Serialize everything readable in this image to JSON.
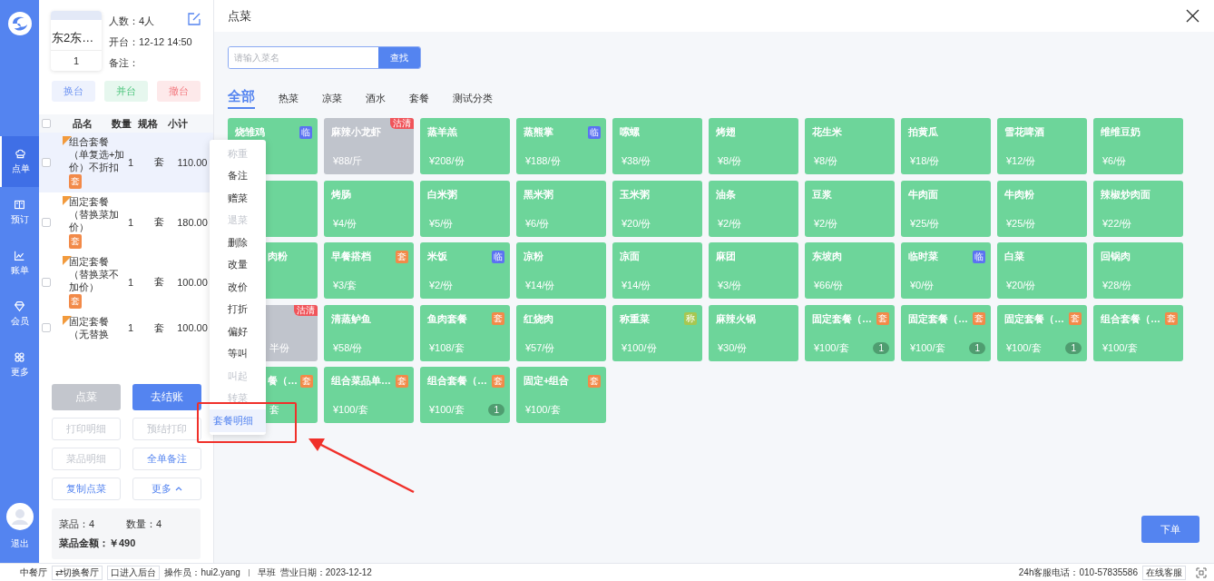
{
  "nav": {
    "items": [
      {
        "label": "点单",
        "selected": true
      },
      {
        "label": "预订",
        "selected": false
      },
      {
        "label": "账单",
        "selected": false
      },
      {
        "label": "会员",
        "selected": false
      },
      {
        "label": "更多",
        "selected": false
      }
    ],
    "logout": "退出"
  },
  "order": {
    "table_name": "东2东…",
    "table_no": "1",
    "guests": "人数：4人",
    "opened": "开台：12-12 14:50",
    "note": "备注：",
    "table_actions": [
      {
        "label": "换台",
        "kind": "blue"
      },
      {
        "label": "并台",
        "kind": "green"
      },
      {
        "label": "撤台",
        "kind": "red"
      }
    ],
    "columns": [
      "品名",
      "数量",
      "规格",
      "小计"
    ],
    "select_all_checked": false,
    "rows": [
      {
        "name": "组合套餐（单复选+加价）不折扣",
        "tag": "套",
        "qty": "1",
        "unit": "套",
        "subtotal": "110.00",
        "selected": true,
        "checked": false
      },
      {
        "name": "固定套餐（替换菜加价）",
        "tag": "套",
        "qty": "1",
        "unit": "套",
        "subtotal": "180.00",
        "selected": false,
        "checked": false
      },
      {
        "name": "固定套餐（替换菜不加价）",
        "tag": "套",
        "qty": "1",
        "unit": "套",
        "subtotal": "100.00",
        "selected": false,
        "checked": false
      },
      {
        "name": "固定套餐（无替换",
        "qty": "1",
        "unit": "套",
        "subtotal": "100.00",
        "selected": false,
        "checked": false
      }
    ],
    "buttons": [
      {
        "label": "点菜",
        "kind": "grey"
      },
      {
        "label": "去结账",
        "kind": "primary"
      },
      {
        "label": "打印明细",
        "kind": "disabled"
      },
      {
        "label": "预结打印",
        "kind": "disabled"
      },
      {
        "label": "菜品明细",
        "kind": "disabled"
      },
      {
        "label": "全单备注",
        "kind": "outline"
      },
      {
        "label": "复制点菜",
        "kind": "outline"
      },
      {
        "label": "更多",
        "kind": "more"
      }
    ],
    "summary": {
      "items": "菜品：4",
      "quantity": "数量：4",
      "amount": "菜品金额：￥490"
    }
  },
  "panel": {
    "title": "点菜",
    "search": {
      "placeholder": "请输入菜名",
      "button": "查找"
    },
    "categories": [
      {
        "label": "全部",
        "selected": true
      },
      {
        "label": "热菜",
        "selected": false
      },
      {
        "label": "凉菜",
        "selected": false
      },
      {
        "label": "酒水",
        "selected": false
      },
      {
        "label": "套餐",
        "selected": false
      },
      {
        "label": "测试分类",
        "selected": false
      }
    ],
    "dishes": [
      {
        "name": "烧雏鸡",
        "tag": {
          "text": "临",
          "kind": "temp"
        },
        "clipped": false,
        "sold_out": false
      },
      {
        "name": "麻辣小龙虾",
        "price": "¥88/斤",
        "sold_out": true,
        "sold_out_label": "沽清",
        "clipped": false
      },
      {
        "name": "蒸羊羔",
        "price": "¥208/份",
        "sold_out": false,
        "clipped": false
      },
      {
        "name": "蒸熊掌",
        "tag": {
          "text": "临",
          "kind": "temp"
        },
        "price": "¥188/份",
        "sold_out": false,
        "clipped": false
      },
      {
        "name": "嗦螺",
        "price": "¥38/份",
        "sold_out": false,
        "clipped": false
      },
      {
        "name": "烤翅",
        "price": "¥8/份",
        "sold_out": false,
        "clipped": false
      },
      {
        "name": "花生米",
        "price": "¥8/份",
        "sold_out": false,
        "clipped": false
      },
      {
        "name": "拍黄瓜",
        "price": "¥18/份",
        "sold_out": false,
        "clipped": false
      },
      {
        "name": "雪花啤酒",
        "price": "¥12/份",
        "sold_out": false,
        "clipped": false
      },
      {
        "name": "维维豆奶",
        "price": "¥6/份",
        "sold_out": false,
        "clipped": false
      },
      {
        "sold_out": false
      },
      {
        "name": "烤肠",
        "price": "¥4/份",
        "sold_out": false,
        "clipped": false
      },
      {
        "name": "白米粥",
        "price": "¥5/份",
        "sold_out": false,
        "clipped": false
      },
      {
        "name": "黑米粥",
        "price": "¥6/份",
        "sold_out": false,
        "clipped": false
      },
      {
        "name": "玉米粥",
        "price": "¥20/份",
        "sold_out": false,
        "clipped": false
      },
      {
        "name": "油条",
        "price": "¥2/份",
        "sold_out": false,
        "clipped": false
      },
      {
        "name": "豆浆",
        "price": "¥2/份",
        "sold_out": false,
        "clipped": false
      },
      {
        "name": "牛肉面",
        "price": "¥25/份",
        "sold_out": false,
        "clipped": false
      },
      {
        "name": "牛肉粉",
        "price": "¥25/份",
        "sold_out": false,
        "clipped": false
      },
      {
        "name": "辣椒炒肉面",
        "price": "¥22/份",
        "sold_out": false,
        "clipped": false
      },
      {
        "name": "肉粉",
        "sold_out": false,
        "clipped": true
      },
      {
        "name": "早餐搭档",
        "tag": {
          "text": "套",
          "kind": "set"
        },
        "price": "¥3/套",
        "sold_out": false,
        "clipped": false
      },
      {
        "name": "米饭",
        "tag": {
          "text": "临",
          "kind": "temp"
        },
        "price": "¥2/份",
        "sold_out": false,
        "clipped": false
      },
      {
        "name": "凉粉",
        "price": "¥14/份",
        "sold_out": false,
        "clipped": false
      },
      {
        "name": "凉面",
        "price": "¥14/份",
        "sold_out": false,
        "clipped": false
      },
      {
        "name": "麻团",
        "price": "¥3/份",
        "sold_out": false,
        "clipped": false
      },
      {
        "name": "东坡肉",
        "price": "¥66/份",
        "sold_out": false,
        "clipped": false
      },
      {
        "name": "临时菜",
        "tag": {
          "text": "临",
          "kind": "temp"
        },
        "price": "¥0/份",
        "sold_out": false,
        "clipped": false
      },
      {
        "name": "白菜",
        "price": "¥20/份",
        "sold_out": false,
        "clipped": false
      },
      {
        "name": "回锅肉",
        "price": "¥28/份",
        "sold_out": false,
        "clipped": false
      },
      {
        "price": "半份",
        "sold_out": true,
        "sold_out_label": "沽清",
        "clipped": true
      },
      {
        "name": "清蒸鲈鱼",
        "price": "¥58/份",
        "sold_out": false,
        "clipped": false
      },
      {
        "name": "鱼肉套餐",
        "tag": {
          "text": "套",
          "kind": "set"
        },
        "price": "¥108/套",
        "sold_out": false,
        "clipped": false
      },
      {
        "name": "红烧肉",
        "price": "¥57/份",
        "sold_out": false,
        "clipped": false
      },
      {
        "name": "称重菜",
        "tag": {
          "text": "称",
          "kind": "weight"
        },
        "price": "¥100/份",
        "sold_out": false,
        "clipped": false
      },
      {
        "name": "麻辣火锅",
        "price": "¥30/份",
        "sold_out": false,
        "clipped": false
      },
      {
        "name": "固定套餐（…",
        "tag": {
          "text": "套",
          "kind": "set"
        },
        "price": "¥100/套",
        "count": "1",
        "sold_out": false,
        "clipped": false
      },
      {
        "name": "固定套餐（…",
        "tag": {
          "text": "套",
          "kind": "set"
        },
        "price": "¥100/套",
        "count": "1",
        "sold_out": false,
        "clipped": false
      },
      {
        "name": "固定套餐（…",
        "tag": {
          "text": "套",
          "kind": "set"
        },
        "price": "¥100/套",
        "count": "1",
        "sold_out": false,
        "clipped": false
      },
      {
        "name": "组合套餐（…",
        "tag": {
          "text": "套",
          "kind": "set"
        },
        "price": "¥100/套",
        "sold_out": false,
        "clipped": false
      },
      {
        "name": "餐（…",
        "tag": {
          "text": "套",
          "kind": "set"
        },
        "price": "套",
        "sold_out": false,
        "clipped": true
      },
      {
        "name": "组合菜品单…",
        "tag": {
          "text": "套",
          "kind": "set"
        },
        "price": "¥100/套",
        "sold_out": false,
        "clipped": false
      },
      {
        "name": "组合套餐（…",
        "tag": {
          "text": "套",
          "kind": "set"
        },
        "price": "¥100/套",
        "count": "1",
        "sold_out": false,
        "clipped": false
      },
      {
        "name": "固定+组合",
        "tag": {
          "text": "套",
          "kind": "set"
        },
        "price": "¥100/套",
        "sold_out": false,
        "clipped": false
      }
    ],
    "submit": "下单"
  },
  "context_menu": [
    {
      "label": "称重",
      "disabled": true,
      "selected": false
    },
    {
      "label": "备注",
      "disabled": false,
      "selected": false
    },
    {
      "label": "赠菜",
      "disabled": false,
      "selected": false
    },
    {
      "label": "退菜",
      "disabled": true,
      "selected": false
    },
    {
      "label": "删除",
      "disabled": false,
      "selected": false
    },
    {
      "label": "改量",
      "disabled": false,
      "selected": false
    },
    {
      "label": "改价",
      "disabled": false,
      "selected": false
    },
    {
      "label": "打折",
      "disabled": false,
      "selected": false
    },
    {
      "label": "偏好",
      "disabled": false,
      "selected": false
    },
    {
      "label": "等叫",
      "disabled": false,
      "selected": false
    },
    {
      "label": "叫起",
      "disabled": true,
      "selected": false
    },
    {
      "label": "转菜",
      "disabled": true,
      "selected": false
    },
    {
      "label": "套餐明细",
      "disabled": false,
      "selected": true
    }
  ],
  "status_bar": {
    "restaurant": "中餐厅",
    "switch": "⇄切换餐厅",
    "backend": "口进入后台",
    "operator": "操作员：hui2.yang",
    "shift": "早班",
    "date": "营业日期：2023-12-12",
    "hotline": "24h客服电话：010-57835586",
    "support": "在线客服"
  }
}
